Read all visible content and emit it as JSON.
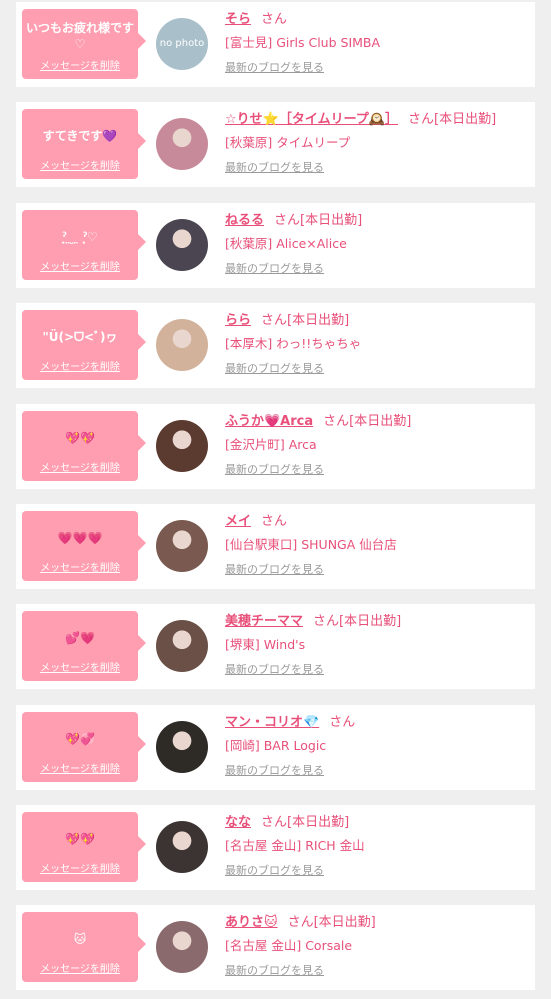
{
  "delete_label": "メッセージを削除",
  "san_label": "さん",
  "today_label": "[本日出勤]",
  "blog_label": "最新のブログを見る",
  "nophoto_label": "no photo",
  "items": [
    {
      "message": "いつもお疲れ様です♡",
      "name": "そら",
      "today": "",
      "shop": "[富士見] Girls Club SIMBA",
      "avatar_color": "#a9bfc9"
    },
    {
      "message": "すてきです💜",
      "name": "☆りせ⭐［タイムリープ🕰️］",
      "today": "[本日出勤]",
      "shop": "[秋葉原] タイムリープ",
      "avatar_color": "#c78a9a"
    },
    {
      "message": "ˀ̣ ̤ ̮ ̤ ˀ̣♡",
      "name": "ねるる",
      "today": "[本日出勤]",
      "shop": "[秋葉原] Alice×Alice",
      "avatar_color": "#4a4550"
    },
    {
      "message": "\"Ü(>ᗜ<ﾞ)ヮ",
      "name": "らら",
      "today": "[本日出勤]",
      "shop": "[本厚木] わっ!!ちゃちゃ",
      "avatar_color": "#d2b29a"
    },
    {
      "message": "💖💖",
      "name": "ふうか💗Arca",
      "today": "[本日出勤]",
      "shop": "[金沢片町] Arca",
      "avatar_color": "#5b3a30"
    },
    {
      "message": "💗💗💗",
      "name": "メイ",
      "today": "",
      "shop": "[仙台駅東口] SHUNGA 仙台店",
      "avatar_color": "#7a5a50"
    },
    {
      "message": "💕💗",
      "name": "美穂チーママ",
      "today": "[本日出勤]",
      "shop": "[堺東] Wind's",
      "avatar_color": "#6b5048"
    },
    {
      "message": "💖💞",
      "name": "マン・コリオ💎",
      "today": "",
      "shop": "[岡崎] BAR Logic",
      "avatar_color": "#2e2a26"
    },
    {
      "message": "💖💖",
      "name": "なな",
      "today": "[本日出勤]",
      "shop": "[名古屋 金山] RICH 金山",
      "avatar_color": "#3c3432"
    },
    {
      "message": "🐱",
      "name": "ありさ🐱",
      "today": "[本日出勤]",
      "shop": "[名古屋 金山] Corsale",
      "avatar_color": "#8b6a6e"
    }
  ]
}
